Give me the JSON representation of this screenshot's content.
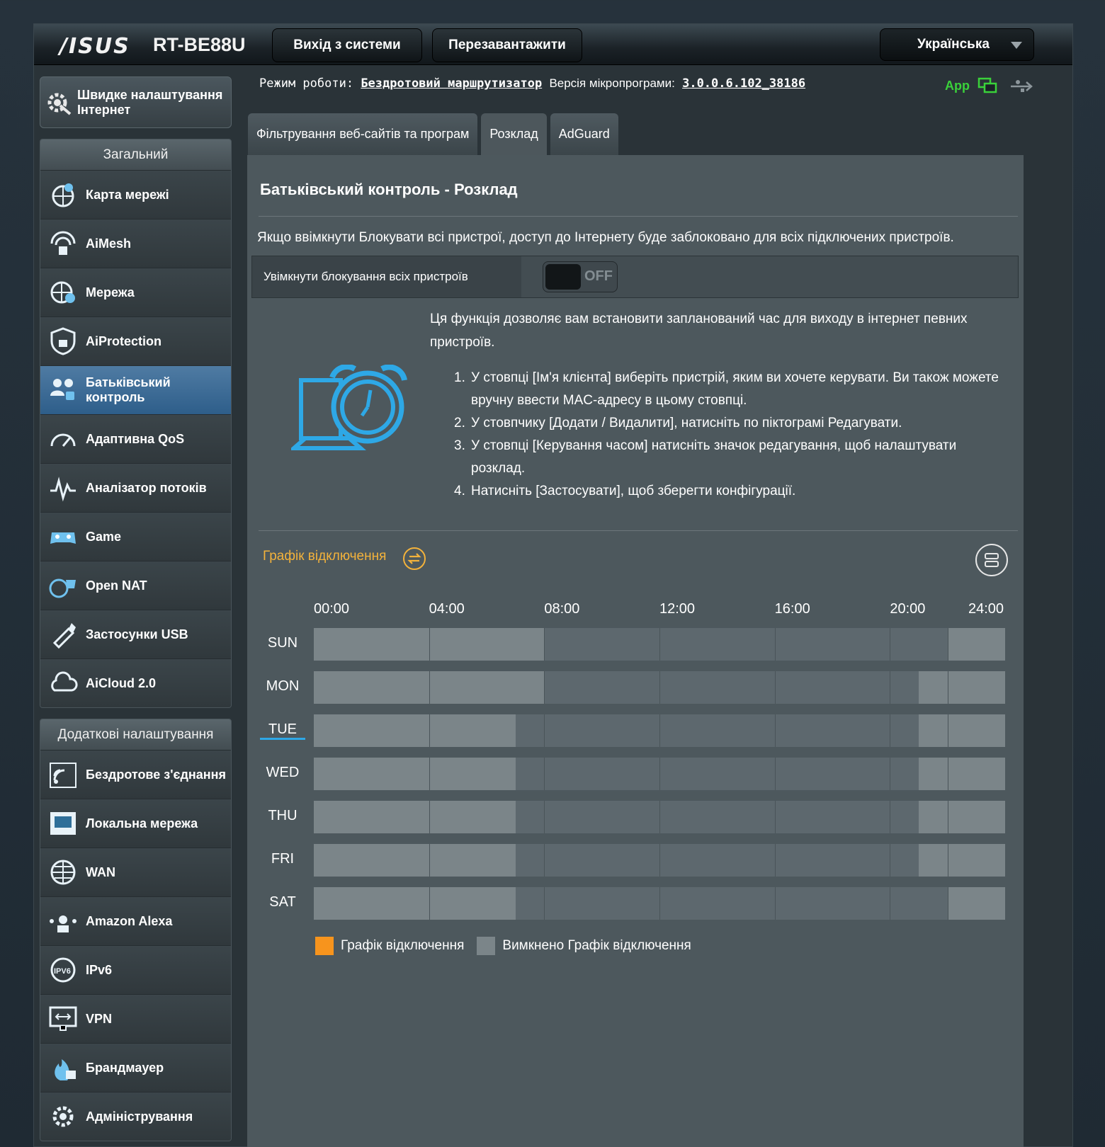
{
  "header": {
    "logo": "/ISUS",
    "model": "RT-BE88U",
    "logout": "Вихід з системи",
    "reboot": "Перезавантажити",
    "language": "Українська"
  },
  "status": {
    "mode_label": "Режим роботи:",
    "mode_value": "Бездротовий маршрутизатор",
    "fw_label": "Версія мікропрограми:",
    "fw_value": "3.0.0.6.102_38186",
    "app": "App"
  },
  "sidebar": {
    "quick_setup": "Швидке налаштування Інтернет",
    "general_head": "Загальний",
    "general_items": [
      {
        "label": "Карта мережі",
        "icon": "network-map-icon"
      },
      {
        "label": "AiMesh",
        "icon": "aimesh-icon"
      },
      {
        "label": "Мережа",
        "icon": "network-icon"
      },
      {
        "label": "AiProtection",
        "icon": "aiprotection-icon"
      },
      {
        "label": "Батьківський контроль",
        "icon": "parental-control-icon",
        "active": true
      },
      {
        "label": "Адаптивна QoS",
        "icon": "qos-icon"
      },
      {
        "label": "Аналізатор потоків",
        "icon": "traffic-analyzer-icon"
      },
      {
        "label": "Game",
        "icon": "game-icon"
      },
      {
        "label": "Open NAT",
        "icon": "open-nat-icon"
      },
      {
        "label": "Застосунки USB",
        "icon": "usb-icon"
      },
      {
        "label": "AiCloud 2.0",
        "icon": "aicloud-icon"
      }
    ],
    "advanced_head": "Додаткові налаштування",
    "advanced_items": [
      {
        "label": "Бездротове з'єднання",
        "icon": "wireless-icon"
      },
      {
        "label": "Локальна мережа",
        "icon": "lan-icon"
      },
      {
        "label": "WAN",
        "icon": "wan-icon"
      },
      {
        "label": "Amazon Alexa",
        "icon": "alexa-icon"
      },
      {
        "label": "IPv6",
        "icon": "ipv6-icon"
      },
      {
        "label": "VPN",
        "icon": "vpn-icon"
      },
      {
        "label": "Брандмауер",
        "icon": "firewall-icon"
      },
      {
        "label": "Адміністрування",
        "icon": "administration-icon"
      }
    ]
  },
  "tabs": [
    {
      "label": "Фільтрування веб-сайтів та програм"
    },
    {
      "label": "Розклад",
      "active": true
    },
    {
      "label": "AdGuard"
    }
  ],
  "panel": {
    "title": "Батьківський контроль - Розклад",
    "note": "Якщо ввімкнути Блокувати всі пристрої, доступ до Інтернету буде заблоковано для всіх підключених пристроїв.",
    "block_all_label": "Увімкнути блокування всіх пристроїв",
    "block_all_state": "OFF",
    "description": "Ця функція дозволяє вам встановити запланований час для виходу в інтернет певних пристроїв.",
    "steps": [
      "У стовпці [Ім'я клієнта] виберіть пристрій, яким ви хочете керувати. Ви також можете вручну ввести MAC-адресу в цьому стовпці.",
      "У стовпчику [Додати / Видалити], натисніть по піктограмі Редагувати.",
      "У стовпці [Керування часом] натисніть значок редагування, щоб налаштувати розклад.",
      "Натисніть [Застосувати], щоб зберегти конфігурації."
    ],
    "schedule_title": "Графік відключення",
    "legend": [
      {
        "label": "Графік відключення",
        "color": "#f7941d"
      },
      {
        "label": "Вимкнено Графік відключення",
        "color": "#7b8589"
      }
    ]
  },
  "chart_data": {
    "type": "heatmap",
    "x_ticks": [
      "00:00",
      "04:00",
      "08:00",
      "12:00",
      "16:00",
      "20:00",
      "24:00"
    ],
    "xlim": [
      0,
      24
    ],
    "days": [
      "SUN",
      "MON",
      "TUE",
      "WED",
      "THU",
      "FRI",
      "SAT"
    ],
    "selected_day": "TUE",
    "offline_blocks_hours": [
      [
        [
          0,
          8
        ],
        [
          22,
          24
        ]
      ],
      [
        [
          0,
          8
        ],
        [
          21,
          24
        ]
      ],
      [
        [
          0,
          7
        ],
        [
          21,
          24
        ]
      ],
      [
        [
          0,
          7
        ],
        [
          21,
          24
        ]
      ],
      [
        [
          0,
          7
        ],
        [
          21,
          24
        ]
      ],
      [
        [
          0,
          7
        ],
        [
          21,
          24
        ]
      ],
      [
        [
          0,
          7
        ],
        [
          22,
          24
        ]
      ]
    ]
  }
}
